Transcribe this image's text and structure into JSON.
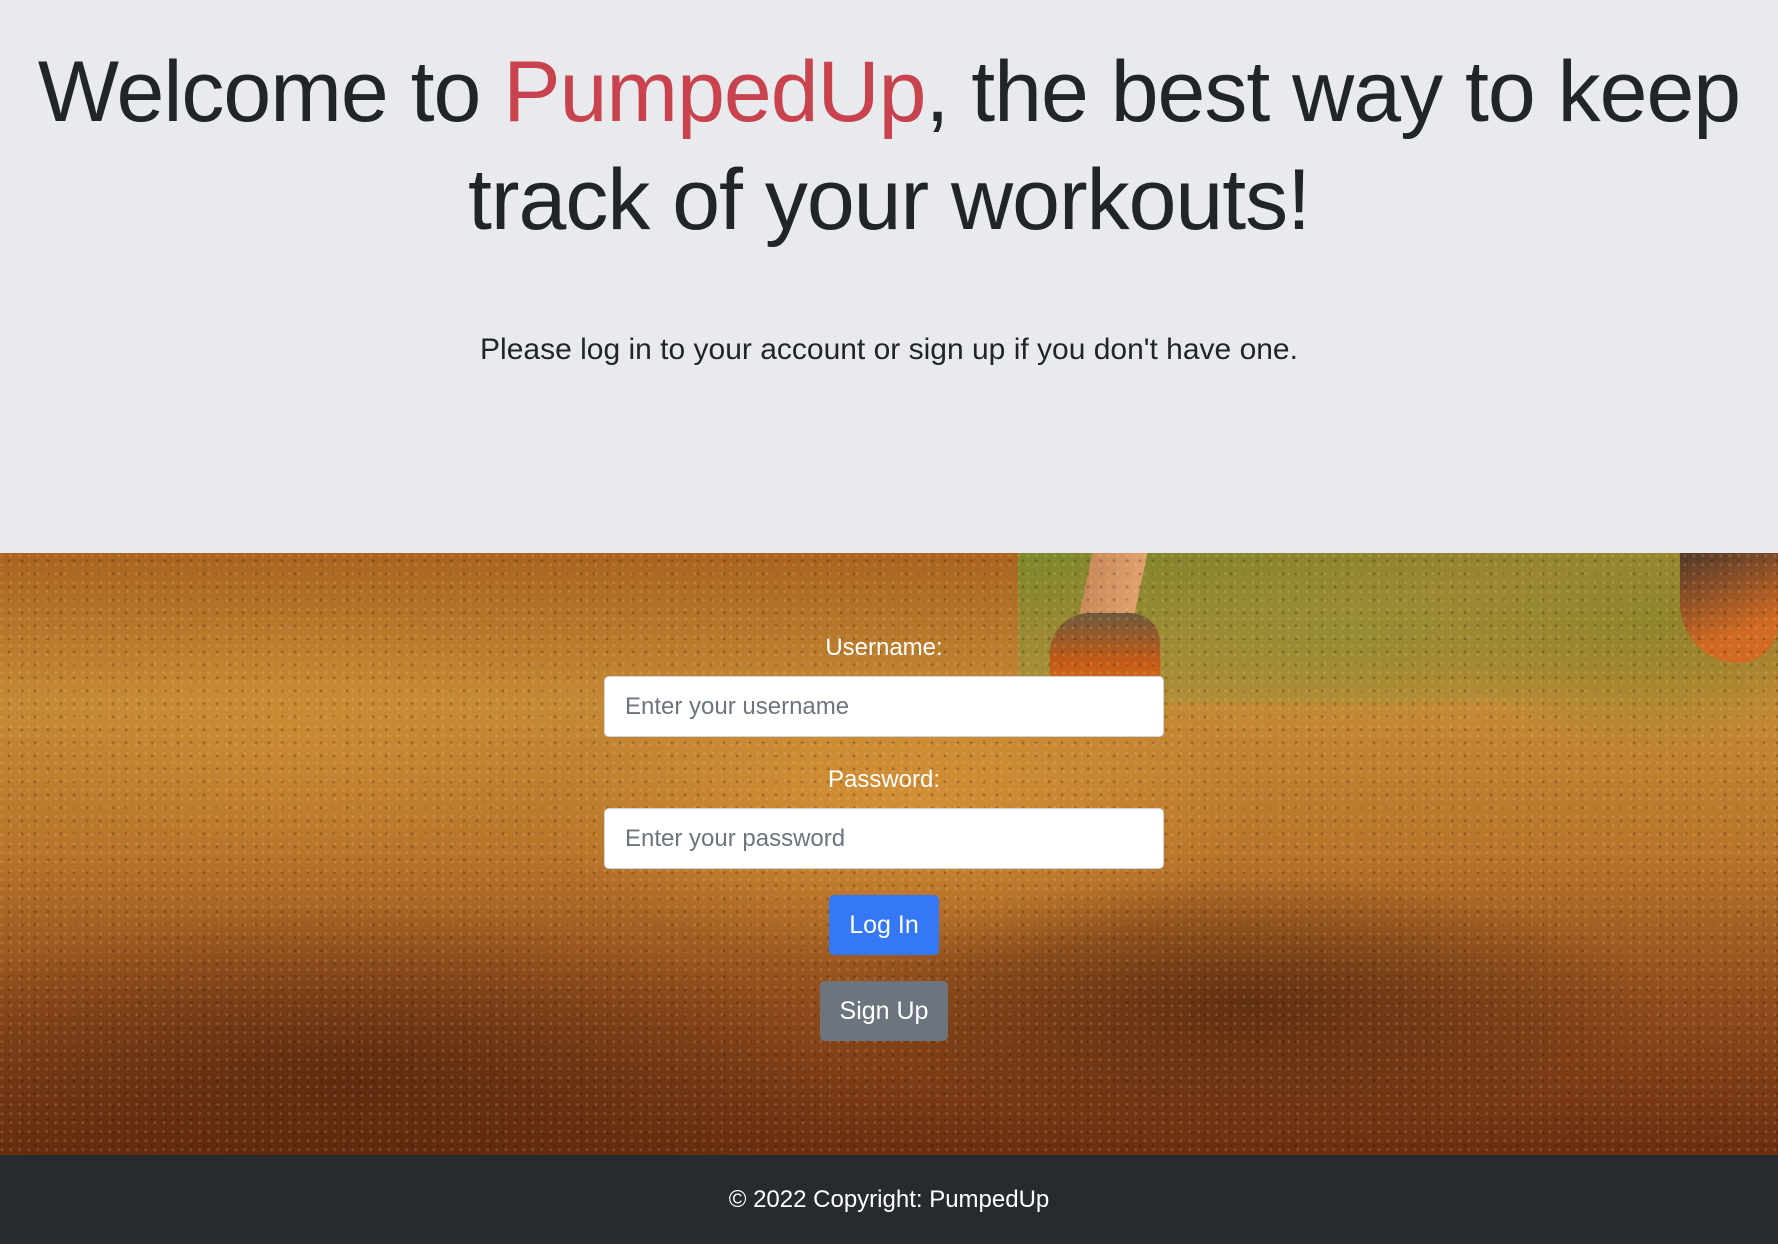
{
  "hero": {
    "title_prefix": "Welcome to ",
    "title_brand": "PumpedUp",
    "title_suffix": ", the best way to keep track of your workouts!",
    "subtitle": "Please log in to your account or sign up if you don't have one."
  },
  "form": {
    "username_label": "Username:",
    "username_placeholder": "Enter your username",
    "username_value": "",
    "password_label": "Password:",
    "password_placeholder": "Enter your password",
    "password_value": "",
    "login_label": "Log In",
    "signup_label": "Sign Up"
  },
  "footer": {
    "copyright": "© 2022 Copyright: PumpedUp"
  },
  "colors": {
    "brand": "#c9434f",
    "primary_button": "#3478f6",
    "secondary_button": "#6c757d",
    "footer_bg": "#272b30",
    "hero_bg": "#e9eaee"
  }
}
